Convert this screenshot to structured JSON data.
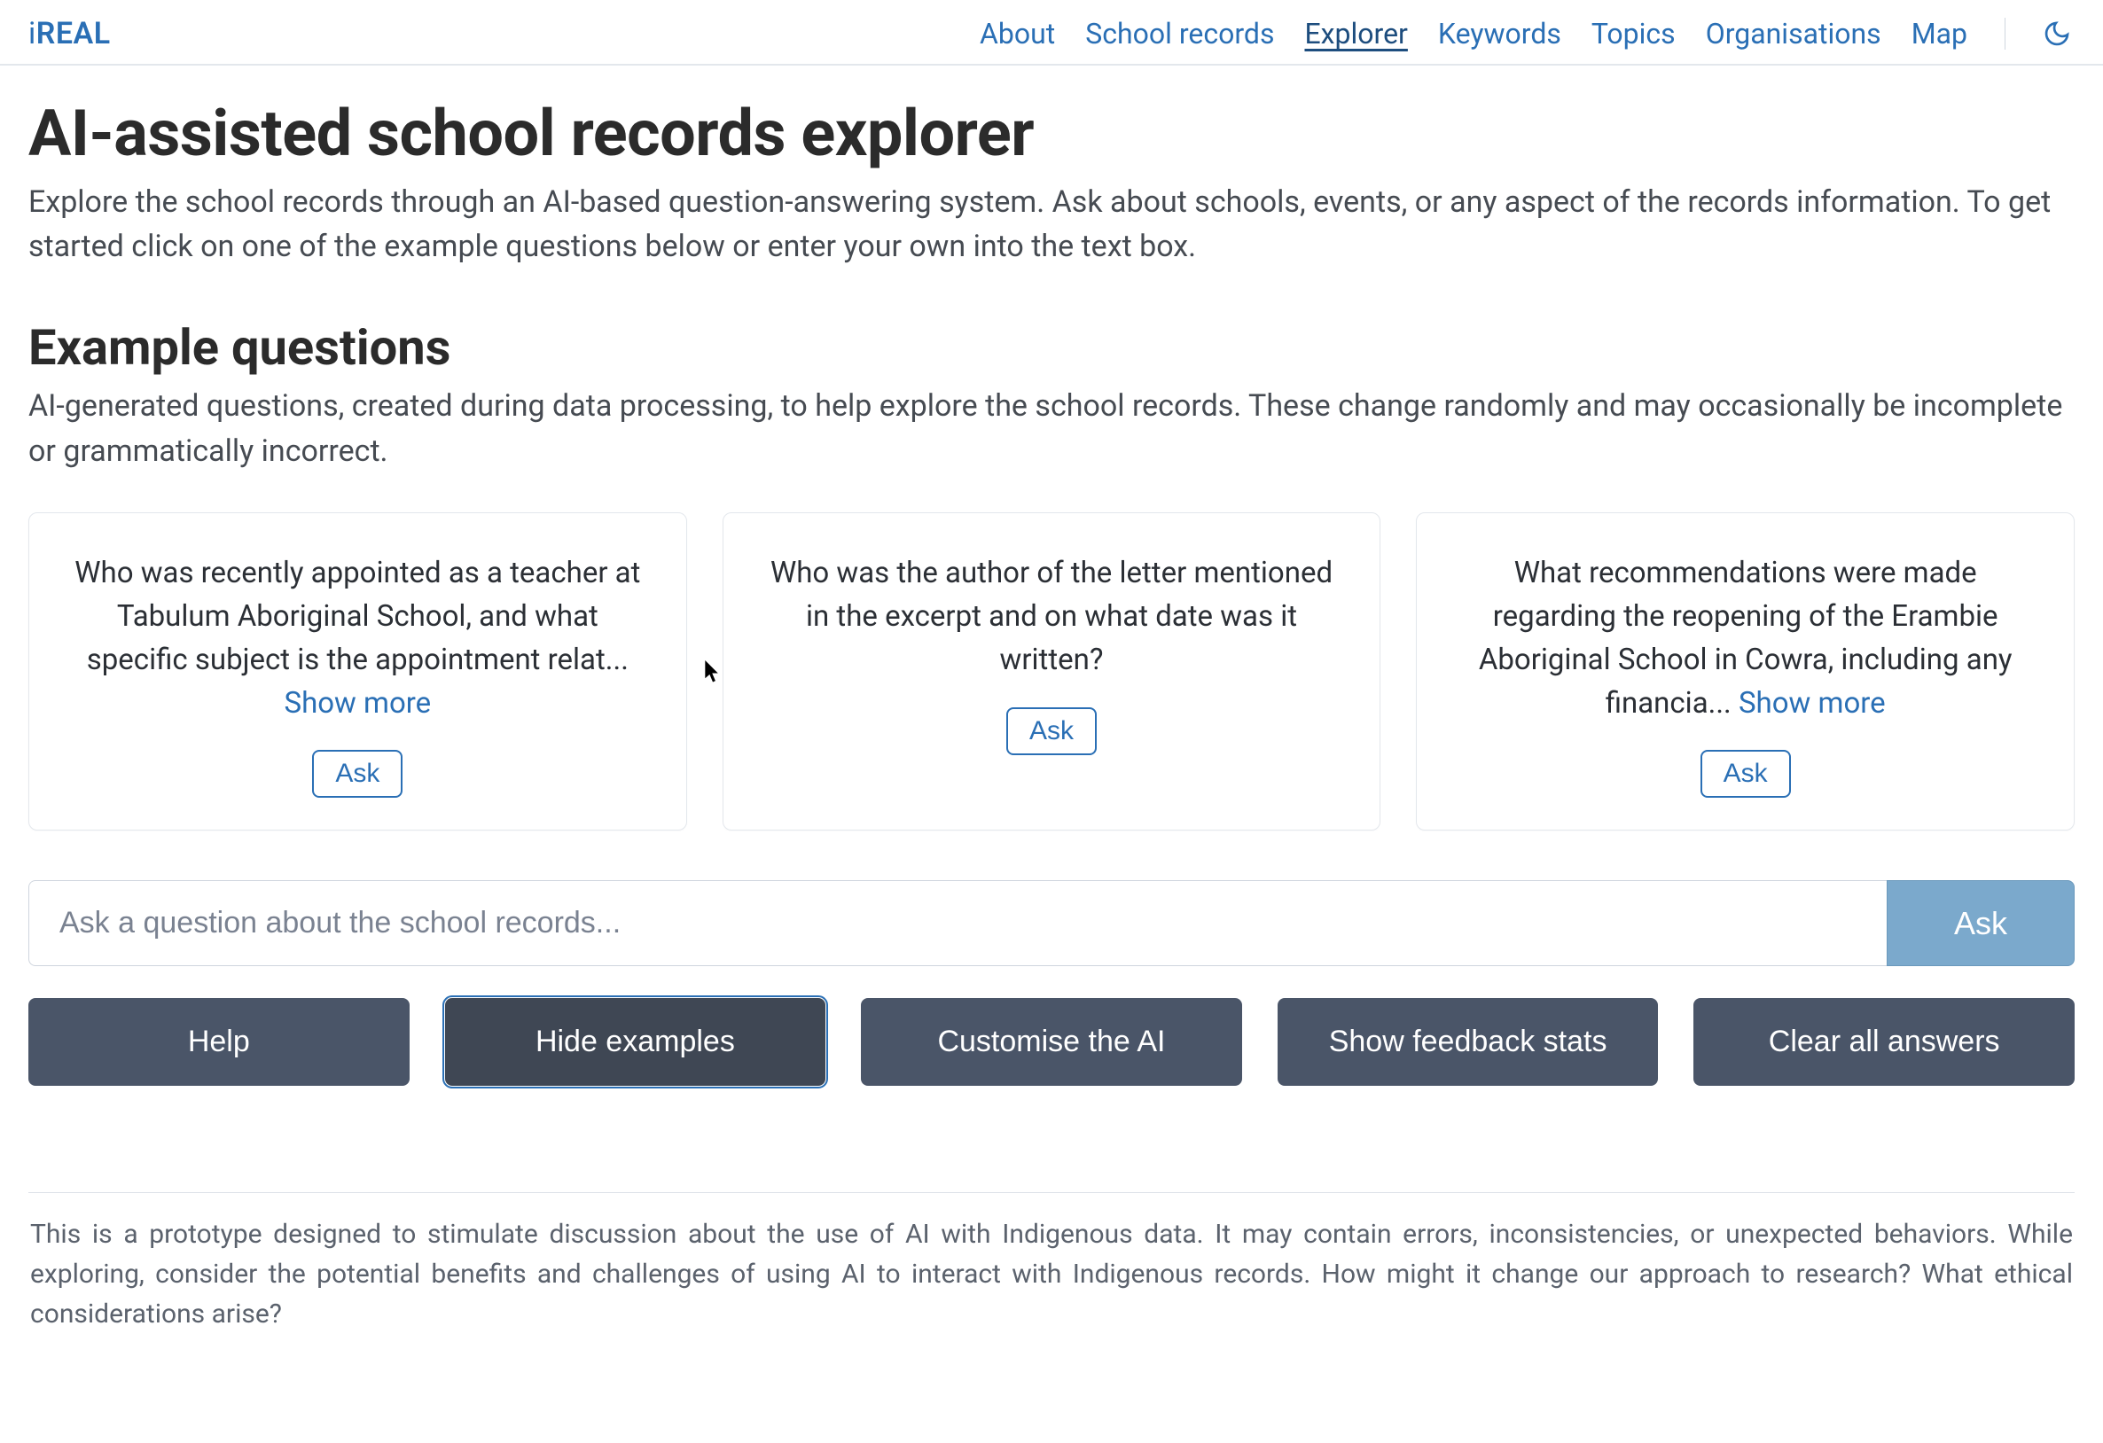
{
  "brand": {
    "prefix": "i",
    "suffix": "REAL"
  },
  "nav": {
    "items": [
      {
        "label": "About",
        "active": false
      },
      {
        "label": "School records",
        "active": false
      },
      {
        "label": "Explorer",
        "active": true
      },
      {
        "label": "Keywords",
        "active": false
      },
      {
        "label": "Topics",
        "active": false
      },
      {
        "label": "Organisations",
        "active": false
      },
      {
        "label": "Map",
        "active": false
      }
    ],
    "theme_toggle_icon": "moon-icon"
  },
  "page": {
    "title": "AI-assisted school records explorer",
    "intro": "Explore the school records through an AI-based question-answering system. Ask about schools, events, or any aspect of the records information. To get started click on one of the example questions below or enter your own into the text box."
  },
  "examples": {
    "heading": "Example questions",
    "description": "AI-generated questions, created during data processing, to help explore the school records. These change randomly and may occasionally be incomplete or grammatically incorrect.",
    "show_more_label": "Show more",
    "ask_label": "Ask",
    "cards": [
      {
        "text": "Who was recently appointed as a teacher at Tabulum Aboriginal School, and what specific subject is the appointment relat... ",
        "truncated": true
      },
      {
        "text": "Who was the author of the letter mentioned in the excerpt and on what date was it written?",
        "truncated": false
      },
      {
        "text": "What recommendations were made regarding the reopening of the Erambie Aboriginal School in Cowra, including any financia... ",
        "truncated": true
      }
    ]
  },
  "input": {
    "placeholder": "Ask a question about the school records...",
    "value": "",
    "submit_label": "Ask"
  },
  "actions": {
    "help": "Help",
    "hide_examples": "Hide examples",
    "customise_ai": "Customise the AI",
    "feedback_stats": "Show feedback stats",
    "clear_answers": "Clear all answers"
  },
  "disclaimer": "This is a prototype designed to stimulate discussion about the use of AI with Indigenous data. It may contain errors, inconsistencies, or unexpected behaviors. While exploring, consider the potential benefits and challenges of using AI to interact with Indigenous records. How might it change our approach to research? What ethical considerations arise?"
}
